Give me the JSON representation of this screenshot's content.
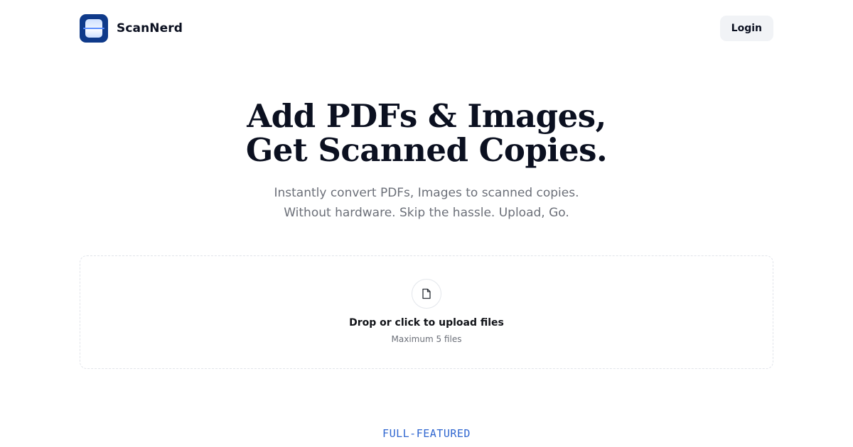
{
  "header": {
    "brand_name": "ScanNerd",
    "logo_icon": "scanner-logo-icon",
    "login_label": "Login"
  },
  "hero": {
    "title_line1": "Add PDFs & Images,",
    "title_line2": "Get Scanned Copies.",
    "subtitle_line1": "Instantly convert PDFs, Images to scanned copies.",
    "subtitle_line2": "Without hardware. Skip the hassle. Upload, Go."
  },
  "upload": {
    "icon": "file-icon",
    "title": "Drop or click to upload files",
    "hint": "Maximum 5 files"
  },
  "features": {
    "label": "FULL-FEATURED"
  },
  "colors": {
    "brand": "#0f3a8a",
    "accent": "#2f66d0",
    "text": "#0b1020",
    "muted": "#6b6f78",
    "button_bg": "#f1f3f6"
  }
}
